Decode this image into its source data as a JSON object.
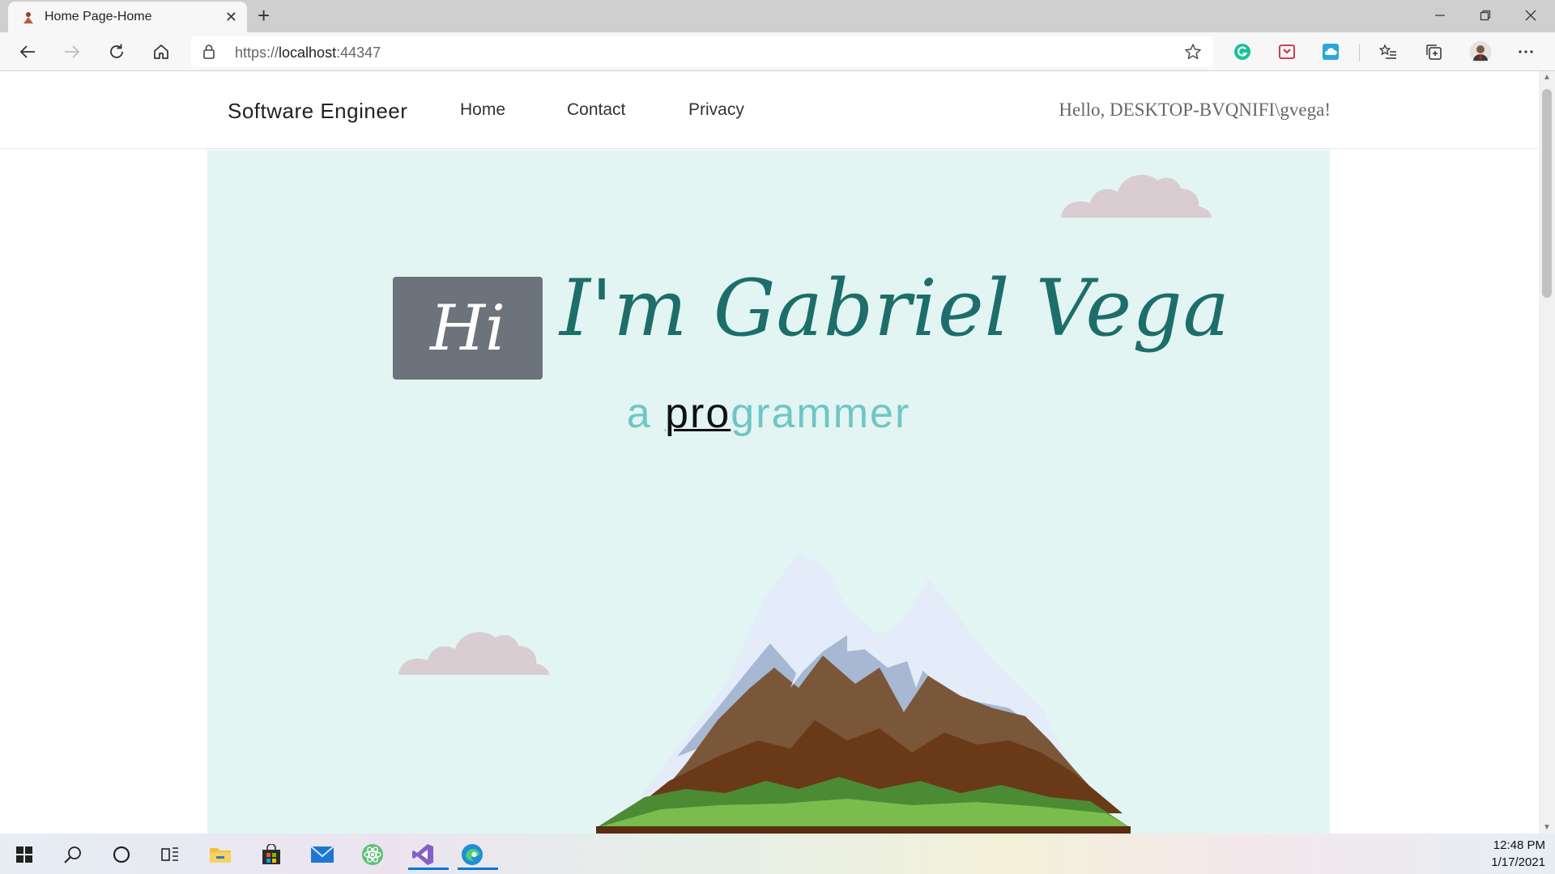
{
  "browser": {
    "tab_title": "Home Page-Home",
    "url_scheme": "https://",
    "url_host": "localhost",
    "url_port": ":44347"
  },
  "site": {
    "brand": "Software Engineer",
    "nav": [
      {
        "label": "Home"
      },
      {
        "label": "Contact"
      },
      {
        "label": "Privacy"
      }
    ],
    "greeting": "Hello, DESKTOP-BVQNIFI\\gvega!"
  },
  "hero": {
    "hi": "Hi",
    "name": "I'm Gabriel Vega",
    "subtitle_prefix": "a ",
    "subtitle_highlight": "pro",
    "subtitle_rest": "grammer",
    "colors": {
      "background": "#e2f5f2",
      "name": "#1d6e6a",
      "subtitle": "#6ec6c6",
      "hi_box": "#6c737a",
      "cloud": "#d9cdd2"
    }
  },
  "taskbar": {
    "apps": [
      "windows-start",
      "search",
      "cortana",
      "task-view",
      "file-explorer",
      "store",
      "mail",
      "atom",
      "visual-studio",
      "edge"
    ],
    "time": "12:48 PM",
    "date": "1/17/2021"
  }
}
